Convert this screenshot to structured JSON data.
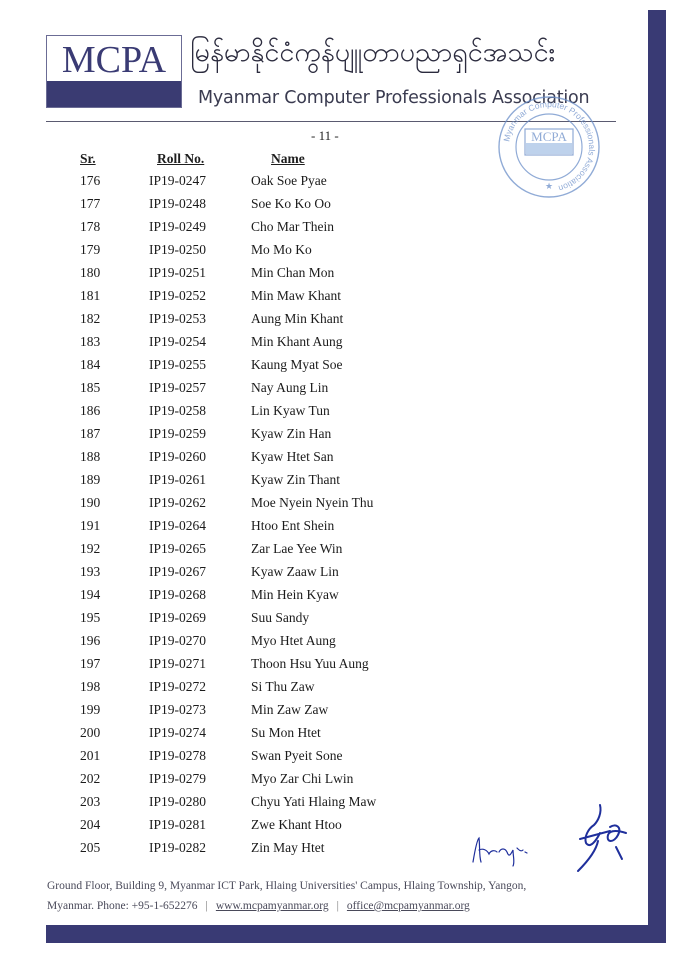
{
  "header": {
    "logo_text": "MCPA",
    "org_name_burmese": "မြန်မာနိုင်ငံကွန်ပျူတာပညာရှင်အသင်း",
    "org_name_english": "Myanmar Computer Professionals Association",
    "stamp": {
      "center_text": "MCPA",
      "ring_text": "Myanmar Computer Professionals Association"
    }
  },
  "page_number": "- 11 -",
  "table": {
    "columns": [
      "Sr.",
      "Roll No.",
      "Name"
    ],
    "rows": [
      {
        "sr": "176",
        "roll": "IP19-0247",
        "name": "Oak Soe Pyae"
      },
      {
        "sr": "177",
        "roll": "IP19-0248",
        "name": "Soe Ko Ko Oo"
      },
      {
        "sr": "178",
        "roll": "IP19-0249",
        "name": "Cho Mar Thein"
      },
      {
        "sr": "179",
        "roll": "IP19-0250",
        "name": "Mo Mo Ko"
      },
      {
        "sr": "180",
        "roll": "IP19-0251",
        "name": "Min Chan Mon"
      },
      {
        "sr": "181",
        "roll": "IP19-0252",
        "name": "Min Maw Khant"
      },
      {
        "sr": "182",
        "roll": "IP19-0253",
        "name": "Aung Min Khant"
      },
      {
        "sr": "183",
        "roll": "IP19-0254",
        "name": "Min Khant Aung"
      },
      {
        "sr": "184",
        "roll": "IP19-0255",
        "name": "Kaung Myat Soe"
      },
      {
        "sr": "185",
        "roll": "IP19-0257",
        "name": "Nay Aung Lin"
      },
      {
        "sr": "186",
        "roll": "IP19-0258",
        "name": "Lin Kyaw Tun"
      },
      {
        "sr": "187",
        "roll": "IP19-0259",
        "name": "Kyaw Zin Han"
      },
      {
        "sr": "188",
        "roll": "IP19-0260",
        "name": "Kyaw Htet San"
      },
      {
        "sr": "189",
        "roll": "IP19-0261",
        "name": "Kyaw Zin Thant"
      },
      {
        "sr": "190",
        "roll": "IP19-0262",
        "name": "Moe Nyein Nyein Thu"
      },
      {
        "sr": "191",
        "roll": "IP19-0264",
        "name": "Htoo Ent Shein"
      },
      {
        "sr": "192",
        "roll": "IP19-0265",
        "name": "Zar Lae Yee Win"
      },
      {
        "sr": "193",
        "roll": "IP19-0267",
        "name": "Kyaw Zaaw Lin"
      },
      {
        "sr": "194",
        "roll": "IP19-0268",
        "name": "Min Hein Kyaw"
      },
      {
        "sr": "195",
        "roll": "IP19-0269",
        "name": "Suu Sandy"
      },
      {
        "sr": "196",
        "roll": "IP19-0270",
        "name": "Myo Htet Aung"
      },
      {
        "sr": "197",
        "roll": "IP19-0271",
        "name": "Thoon Hsu Yuu Aung"
      },
      {
        "sr": "198",
        "roll": "IP19-0272",
        "name": "Si Thu Zaw"
      },
      {
        "sr": "199",
        "roll": "IP19-0273",
        "name": "Min Zaw Zaw"
      },
      {
        "sr": "200",
        "roll": "IP19-0274",
        "name": "Su Mon Htet"
      },
      {
        "sr": "201",
        "roll": "IP19-0278",
        "name": "Swan Pyeit Sone"
      },
      {
        "sr": "202",
        "roll": "IP19-0279",
        "name": "Myo Zar Chi Lwin"
      },
      {
        "sr": "203",
        "roll": "IP19-0280",
        "name": "Chyu Yati Hlaing Maw"
      },
      {
        "sr": "204",
        "roll": "IP19-0281",
        "name": "Zwe Khant Htoo"
      },
      {
        "sr": "205",
        "roll": "IP19-0282",
        "name": "Zin May Htet"
      }
    ]
  },
  "footer": {
    "address_line1": "Ground Floor, Building 9, Myanmar ICT Park, Hlaing Universities' Campus, Hlaing Township, Yangon,",
    "address_line2": "Myanmar. Phone: +95-1-652276",
    "separator": "|",
    "website": "www.mcpamyanmar.org",
    "email": "office@mcpamyanmar.org"
  },
  "colors": {
    "brand_navy": "#393a74",
    "signature_ink": "#1f2f9c"
  }
}
